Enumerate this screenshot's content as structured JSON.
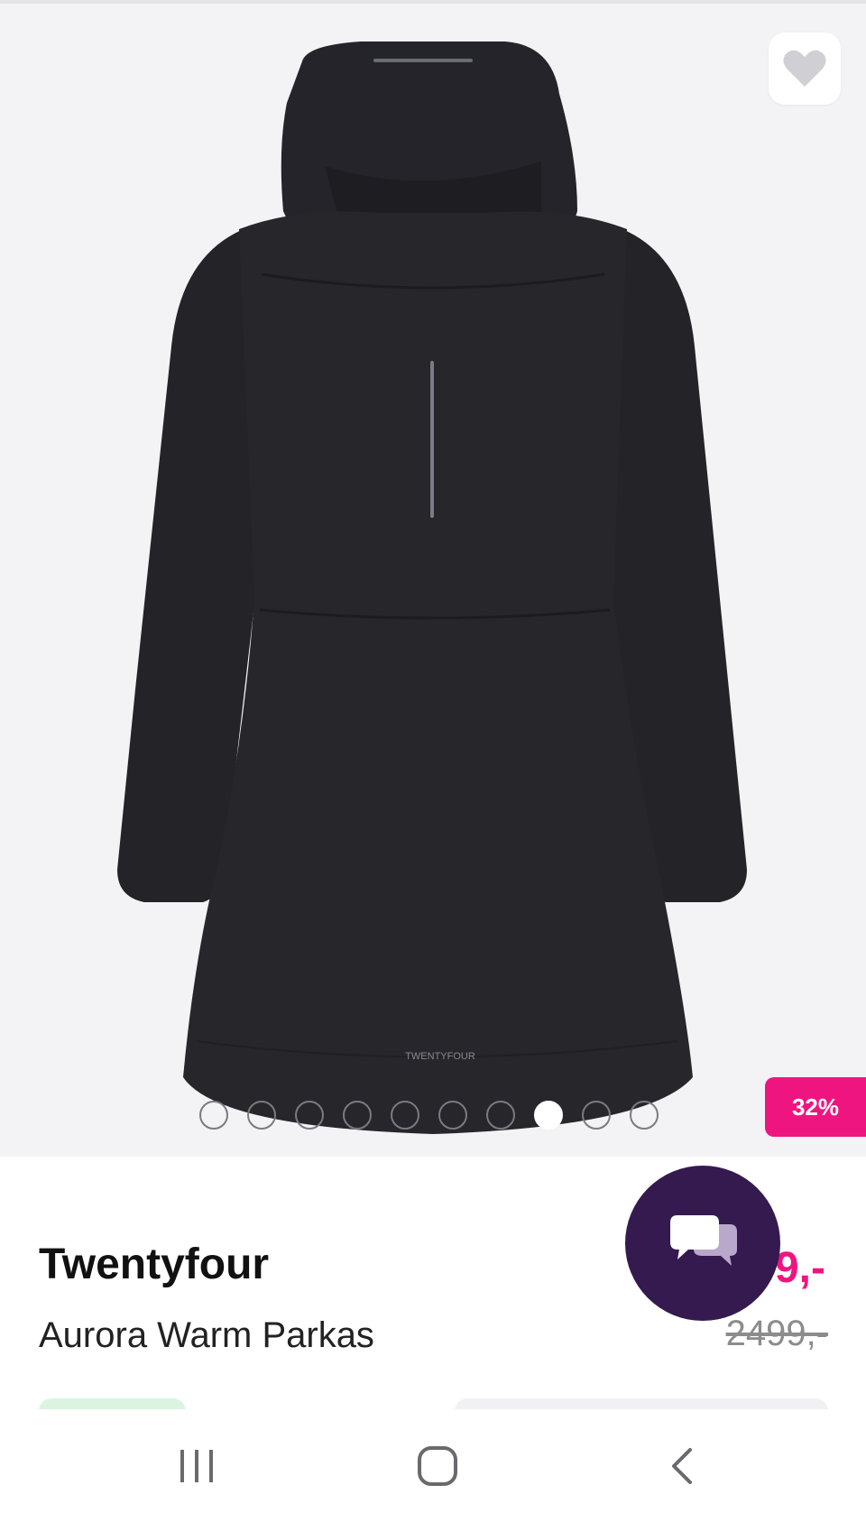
{
  "product": {
    "brand": "Twentyfour",
    "name": "Aurora Warm Parkas",
    "price_partial": "9,-",
    "old_price": "2499,-",
    "discount": "32%",
    "logo_text": "TWENTYFOUR"
  },
  "gallery": {
    "image_count": 10,
    "active_index": 7
  },
  "colors": {
    "accent": "#ef1580",
    "chat_bg": "#341a4f",
    "gallery_bg": "#f3f3f6"
  },
  "icons": {
    "favorite": "heart-icon",
    "chat": "chat-bubbles-icon",
    "recents": "recent-apps-icon",
    "home": "home-icon",
    "back": "back-icon"
  }
}
